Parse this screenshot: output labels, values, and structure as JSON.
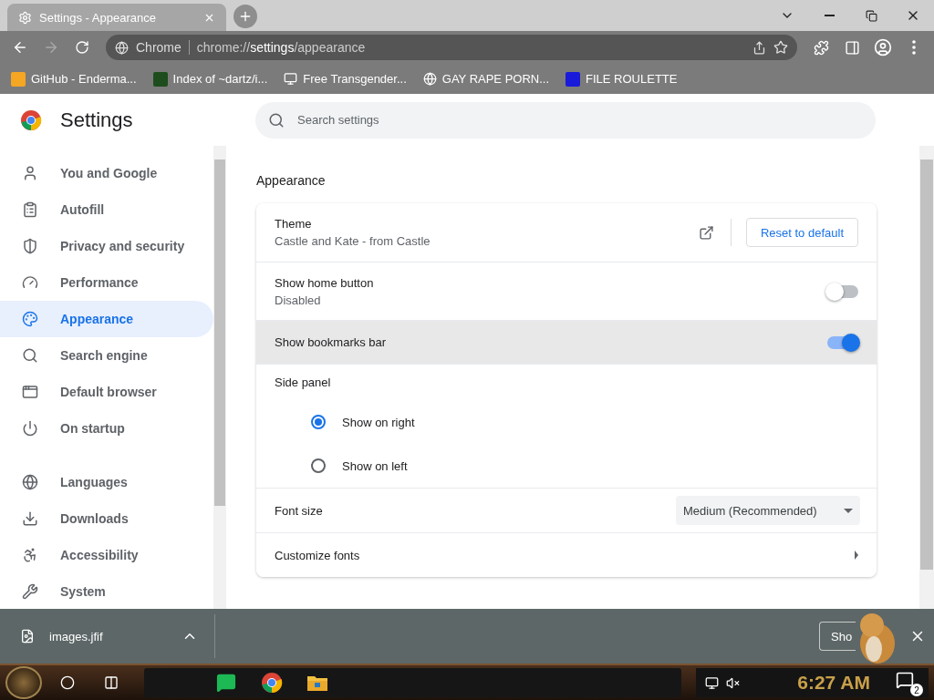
{
  "tab": {
    "title": "Settings - Appearance"
  },
  "omnibox": {
    "site": "Chrome",
    "scheme": "chrome://",
    "host": "settings",
    "path": "/appearance"
  },
  "bookmarks": [
    {
      "label": "GitHub - Enderma...",
      "kind": "ph"
    },
    {
      "label": "Index of ~dartz/i...",
      "kind": "grid"
    },
    {
      "label": "Free Transgender...",
      "kind": "computer"
    },
    {
      "label": "GAY RAPE PORN...",
      "kind": "globe"
    },
    {
      "label": "FILE ROULETTE",
      "kind": "mft"
    }
  ],
  "header": {
    "title": "Settings",
    "search_placeholder": "Search settings"
  },
  "sidebar": {
    "groups": [
      [
        {
          "label": "You and Google",
          "selected": false
        },
        {
          "label": "Autofill",
          "selected": false
        },
        {
          "label": "Privacy and security",
          "selected": false
        },
        {
          "label": "Performance",
          "selected": false
        },
        {
          "label": "Appearance",
          "selected": true
        },
        {
          "label": "Search engine",
          "selected": false
        },
        {
          "label": "Default browser",
          "selected": false
        },
        {
          "label": "On startup",
          "selected": false
        }
      ],
      [
        {
          "label": "Languages",
          "selected": false
        },
        {
          "label": "Downloads",
          "selected": false
        },
        {
          "label": "Accessibility",
          "selected": false
        },
        {
          "label": "System",
          "selected": false
        }
      ]
    ]
  },
  "section": {
    "title": "Appearance"
  },
  "rows": [
    {
      "kind": "theme",
      "title": "Theme",
      "subtitle": "Castle and Kate - from Castle",
      "button": "Reset to default"
    },
    {
      "kind": "toggle",
      "title": "Show home button",
      "subtitle": "Disabled",
      "on": false
    },
    {
      "kind": "toggle",
      "title": "Show bookmarks bar",
      "on": true,
      "highlighted": true
    },
    {
      "kind": "radio",
      "title": "Side panel",
      "options": [
        {
          "label": "Show on right",
          "selected": true
        },
        {
          "label": "Show on left",
          "selected": false
        }
      ]
    },
    {
      "kind": "select",
      "title": "Font size",
      "value": "Medium (Recommended)"
    },
    {
      "kind": "link",
      "title": "Customize fonts"
    }
  ],
  "download_shelf": {
    "file": "images.jfif",
    "button": "Sho"
  },
  "taskbar": {
    "clock": "6:27 AM",
    "notifications": "2"
  }
}
